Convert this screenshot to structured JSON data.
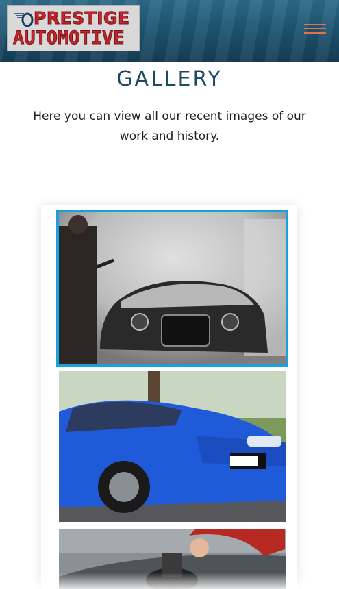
{
  "header": {
    "logo": {
      "line1": "PRESTIGE",
      "line2": "AUTOMOTIVE",
      "emblem_icon": "winged-wheel-icon"
    },
    "menu_icon": "hamburger-menu-icon"
  },
  "intro": {
    "title": "GALLERY",
    "text": "Here you can view all our recent images of our work and history."
  },
  "gallery": {
    "images": [
      {
        "subject": "car-wash-foam-photo",
        "selected": true
      },
      {
        "subject": "blue-bmw-photo",
        "selected": false
      },
      {
        "subject": "polishing-car-photo",
        "selected": false
      }
    ]
  },
  "colors": {
    "header_bg": "#1f5673",
    "title": "#1c4a63",
    "logo_text": "#c0262b",
    "menu": "#e0724f",
    "selected_border": "#1aa0dc"
  }
}
